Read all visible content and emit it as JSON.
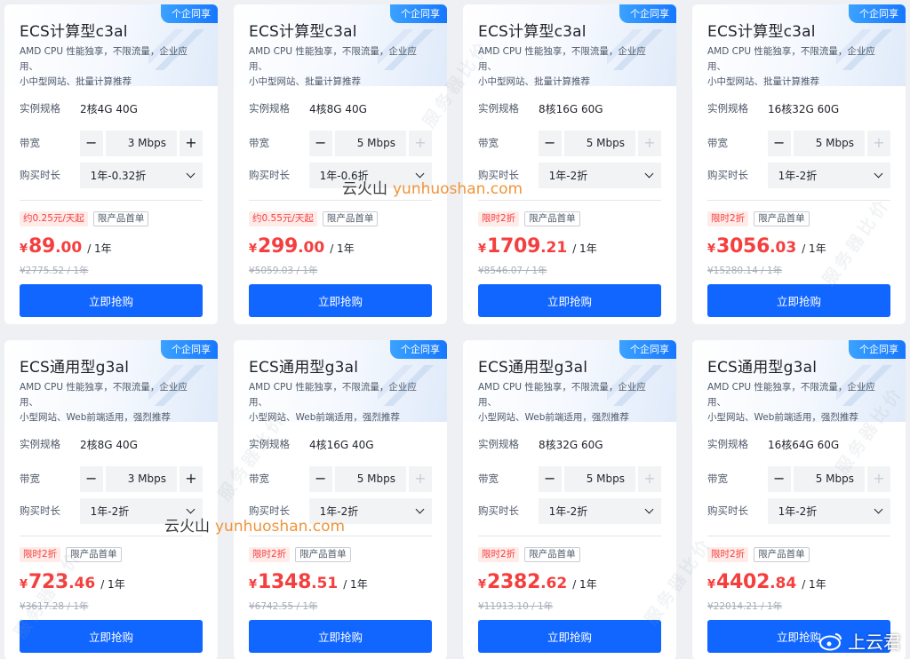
{
  "labels": {
    "spec": "实例规格",
    "bandwidth": "带宽",
    "duration": "购买时长",
    "unit": "/ 1年",
    "buy": "立即抢购",
    "limited": "限产品首单"
  },
  "cards": [
    {
      "tag": "个企同享",
      "title": "ECS计算型c3al",
      "desc1": "AMD CPU 性能独享，不限流量，企业应用、",
      "desc2": "小中型网站、批量计算推荐",
      "spec": "2核4G 40G",
      "bw": "3 Mbps",
      "plus_disabled": false,
      "duration": "1年-0.32折",
      "discount": "约0.25元/天起",
      "yen": "¥",
      "price_int": "89",
      "price_dec": ".00",
      "orig": "¥2775.52 / 1年"
    },
    {
      "tag": "个企同享",
      "title": "ECS计算型c3al",
      "desc1": "AMD CPU 性能独享，不限流量，企业应用、",
      "desc2": "小中型网站、批量计算推荐",
      "spec": "4核8G 40G",
      "bw": "5 Mbps",
      "plus_disabled": true,
      "duration": "1年-0.6折",
      "discount": "约0.55元/天起",
      "yen": "¥",
      "price_int": "299",
      "price_dec": ".00",
      "orig": "¥5059.03 / 1年"
    },
    {
      "tag": "个企同享",
      "title": "ECS计算型c3al",
      "desc1": "AMD CPU 性能独享，不限流量，企业应用、",
      "desc2": "小中型网站、批量计算推荐",
      "spec": "8核16G 60G",
      "bw": "5 Mbps",
      "plus_disabled": true,
      "duration": "1年-2折",
      "discount": "限时2折",
      "yen": "¥",
      "price_int": "1709",
      "price_dec": ".21",
      "orig": "¥8546.07 / 1年"
    },
    {
      "tag": "个企同享",
      "title": "ECS计算型c3al",
      "desc1": "AMD CPU 性能独享，不限流量，企业应用、",
      "desc2": "小中型网站、批量计算推荐",
      "spec": "16核32G 60G",
      "bw": "5 Mbps",
      "plus_disabled": true,
      "duration": "1年-2折",
      "discount": "限时2折",
      "yen": "¥",
      "price_int": "3056",
      "price_dec": ".03",
      "orig": "¥15280.14 / 1年"
    },
    {
      "tag": "个企同享",
      "title": "ECS通用型g3al",
      "desc1": "AMD CPU 性能独享，不限流量，企业应用、",
      "desc2": "小型网站、Web前端适用，强烈推荐",
      "spec": "2核8G 40G",
      "bw": "3 Mbps",
      "plus_disabled": false,
      "duration": "1年-2折",
      "discount": "限时2折",
      "yen": "¥",
      "price_int": "723",
      "price_dec": ".46",
      "orig": "¥3617.28 / 1年"
    },
    {
      "tag": "个企同享",
      "title": "ECS通用型g3al",
      "desc1": "AMD CPU 性能独享，不限流量，企业应用、",
      "desc2": "小型网站、Web前端适用，强烈推荐",
      "spec": "4核16G 40G",
      "bw": "5 Mbps",
      "plus_disabled": true,
      "duration": "1年-2折",
      "discount": "限时2折",
      "yen": "¥",
      "price_int": "1348",
      "price_dec": ".51",
      "orig": "¥6742.55 / 1年"
    },
    {
      "tag": "个企同享",
      "title": "ECS通用型g3al",
      "desc1": "AMD CPU 性能独享，不限流量，企业应用、",
      "desc2": "小型网站、Web前端适用，强烈推荐",
      "spec": "8核32G 60G",
      "bw": "5 Mbps",
      "plus_disabled": true,
      "duration": "1年-2折",
      "discount": "限时2折",
      "yen": "¥",
      "price_int": "2382",
      "price_dec": ".62",
      "orig": "¥11913.10 / 1年"
    },
    {
      "tag": "个企同享",
      "title": "ECS通用型g3al",
      "desc1": "AMD CPU 性能独享，不限流量，企业应用、",
      "desc2": "小型网站、Web前端适用，强烈推荐",
      "spec": "16核64G 60G",
      "bw": "5 Mbps",
      "plus_disabled": true,
      "duration": "1年-2折",
      "discount": "限时2折",
      "yen": "¥",
      "price_int": "4402",
      "price_dec": ".84",
      "orig": "¥22014.21 / 1年"
    }
  ],
  "watermarks": {
    "diag": "服务器比价",
    "site_cn": "云火山",
    "site_en": "yunhuoshan.com",
    "corner": "上云君"
  },
  "colors": {
    "accent": "#1166ff",
    "price": "#f53f3f",
    "tag": "#1677ff"
  },
  "icons": {
    "minus": "−",
    "plus": "+",
    "dropdown": "chevron-down-icon"
  }
}
